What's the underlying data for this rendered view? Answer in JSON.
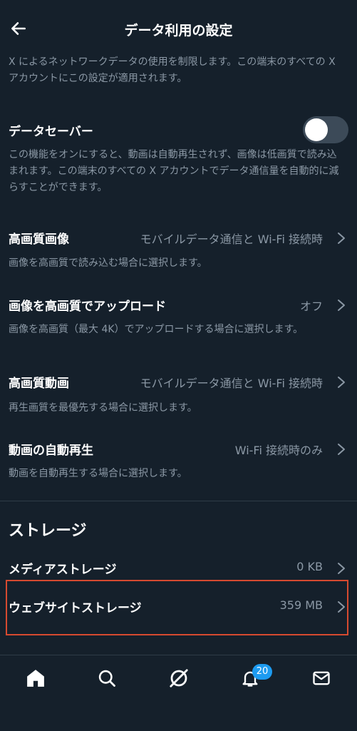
{
  "header": {
    "title": "データ利用の設定",
    "back_icon": "arrow-left-icon"
  },
  "intro": "X によるネットワークデータの使用を制限します。この端末のすべての X アカウントにこの設定が適用されます。",
  "data_saver": {
    "label": "データセーバー",
    "enabled": false,
    "description": "この機能をオンにすると、動画は自動再生されず、画像は低画質で読み込まれます。この端末のすべての X アカウントでデータ通信量を自動的に減らすことができます。"
  },
  "settings": [
    {
      "label": "高画質画像",
      "value": "モバイルデータ通信と Wi-Fi 接続時",
      "description": "画像を高画質で読み込む場合に選択します。"
    },
    {
      "label": "画像を高画質でアップロード",
      "value": "オフ",
      "description": "画像を高画質（最大 4K）でアップロードする場合に選択します。"
    },
    {
      "label": "高画質動画",
      "value": "モバイルデータ通信と Wi-Fi 接続時",
      "description": "再生画質を最優先する場合に選択します。"
    },
    {
      "label": "動画の自動再生",
      "value": "Wi-Fi 接続時のみ",
      "description": "動画を自動再生する場合に選択します。"
    }
  ],
  "storage": {
    "title": "ストレージ",
    "items": [
      {
        "label": "メディアストレージ",
        "value": "0 KB"
      },
      {
        "label": "ウェブサイトストレージ",
        "value": "359 MB"
      }
    ]
  },
  "tabbar": {
    "items": [
      "home-icon",
      "search-icon",
      "communities-icon",
      "notifications-icon",
      "messages-icon"
    ],
    "notification_count": "20"
  },
  "colors": {
    "background": "#15202b",
    "secondary_text": "#8b98a5",
    "accent": "#1d9bf0",
    "highlight_border": "#d64a30"
  }
}
